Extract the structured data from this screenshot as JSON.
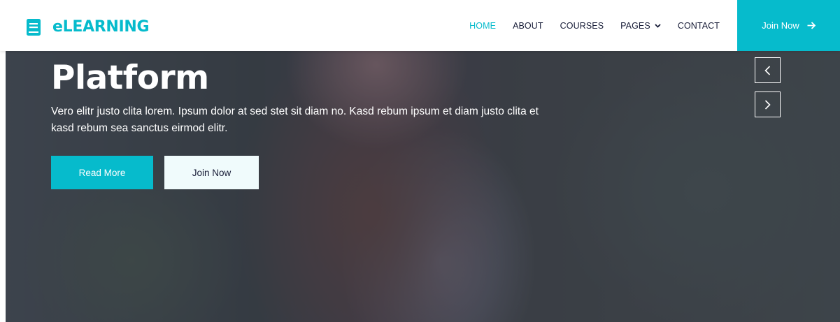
{
  "brand": {
    "name": "eLEARNING",
    "icon": "book-icon"
  },
  "nav": {
    "items": [
      {
        "label": "HOME",
        "active": true
      },
      {
        "label": "ABOUT",
        "active": false
      },
      {
        "label": "COURSES",
        "active": false
      },
      {
        "label": "PAGES",
        "active": false,
        "dropdown": true
      },
      {
        "label": "CONTACT",
        "active": false
      }
    ],
    "join_label": "Join Now"
  },
  "hero": {
    "title": "Platform",
    "text": "Vero elitr justo clita lorem. Ipsum dolor at sed stet sit diam no. Kasd rebum ipsum et diam justo clita et kasd rebum sea sanctus eirmod elitr.",
    "read_more_label": "Read More",
    "join_label": "Join Now"
  },
  "colors": {
    "accent": "#06BBCC",
    "dark": "#181d38",
    "light": "#f0fbfc"
  }
}
